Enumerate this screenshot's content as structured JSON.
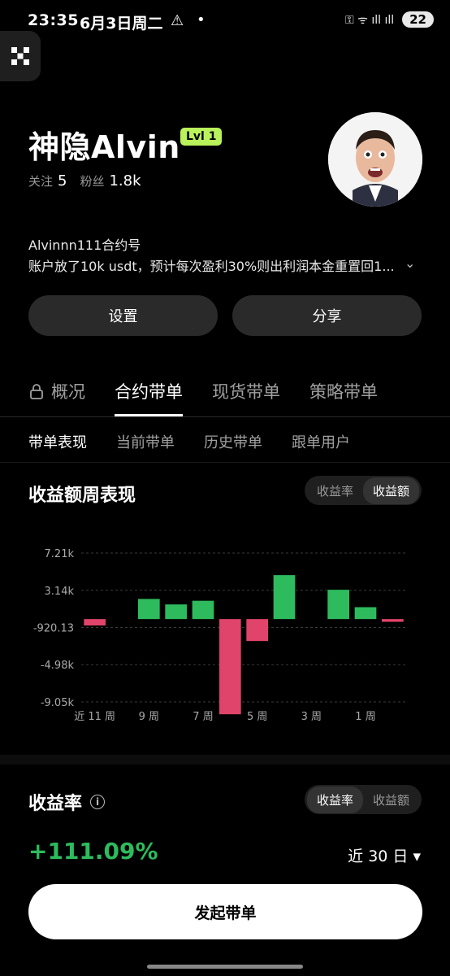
{
  "status": {
    "time": "23:35",
    "date": "6月3日周二",
    "battery": "22",
    "warning": "⚠",
    "dot": "•",
    "signal_text": "⚿  ᯤ ıll ıll"
  },
  "profile": {
    "name": "神隐Alvin",
    "level": "Lvl 1",
    "following_label": "关注",
    "following_count": "5",
    "followers_label": "粉丝",
    "followers_count": "1.8k",
    "bio_title": "Alvinnn111合约号",
    "bio_text": "账户放了10k usdt，预计每次盈利30%则出利润本金重置回1...",
    "expand_icon": "⌄"
  },
  "actions": {
    "settings_label": "设置",
    "share_label": "分享"
  },
  "tabs": [
    {
      "label": "概况"
    },
    {
      "label": "合约带单"
    },
    {
      "label": "现货带单"
    },
    {
      "label": "策略带单"
    }
  ],
  "subtabs": [
    {
      "label": "带单表现"
    },
    {
      "label": "当前带单"
    },
    {
      "label": "历史带单"
    },
    {
      "label": "跟单用户"
    }
  ],
  "weekly": {
    "title": "收益额周表现",
    "toggle_rate": "收益率",
    "toggle_amount": "收益额"
  },
  "chart_data": {
    "type": "bar",
    "title": "收益额周表现",
    "ytick_labels": [
      "7.21k",
      "3.14k",
      "-920.13",
      "-4.98k",
      "-9.05k"
    ],
    "ytick_values": [
      7210,
      3140,
      -920.13,
      -4980,
      -9050
    ],
    "xtick_labels": [
      "近 11 周",
      "9 周",
      "7 周",
      "5 周",
      "3 周",
      "1 周"
    ],
    "xtick_index": [
      0,
      2,
      4,
      6,
      8,
      10
    ],
    "values": [
      -700,
      0,
      2200,
      1600,
      2000,
      -10400,
      -2400,
      4800,
      0,
      3200,
      1300,
      -300
    ],
    "ylim": [
      -9050,
      7210
    ],
    "colors": {
      "positive": "#2dbb5d",
      "negative": "#e0446a"
    },
    "grid": true
  },
  "returns": {
    "title": "收益率",
    "info_icon": "i",
    "toggle_rate": "收益率",
    "toggle_amount": "收益额",
    "value": "+111.09%",
    "period": "近 30 日 ▾"
  },
  "cta": {
    "label": "发起带单"
  },
  "colors": {
    "accent": "#b9f25a",
    "positive": "#2dbb5d",
    "negative": "#e0446a"
  }
}
